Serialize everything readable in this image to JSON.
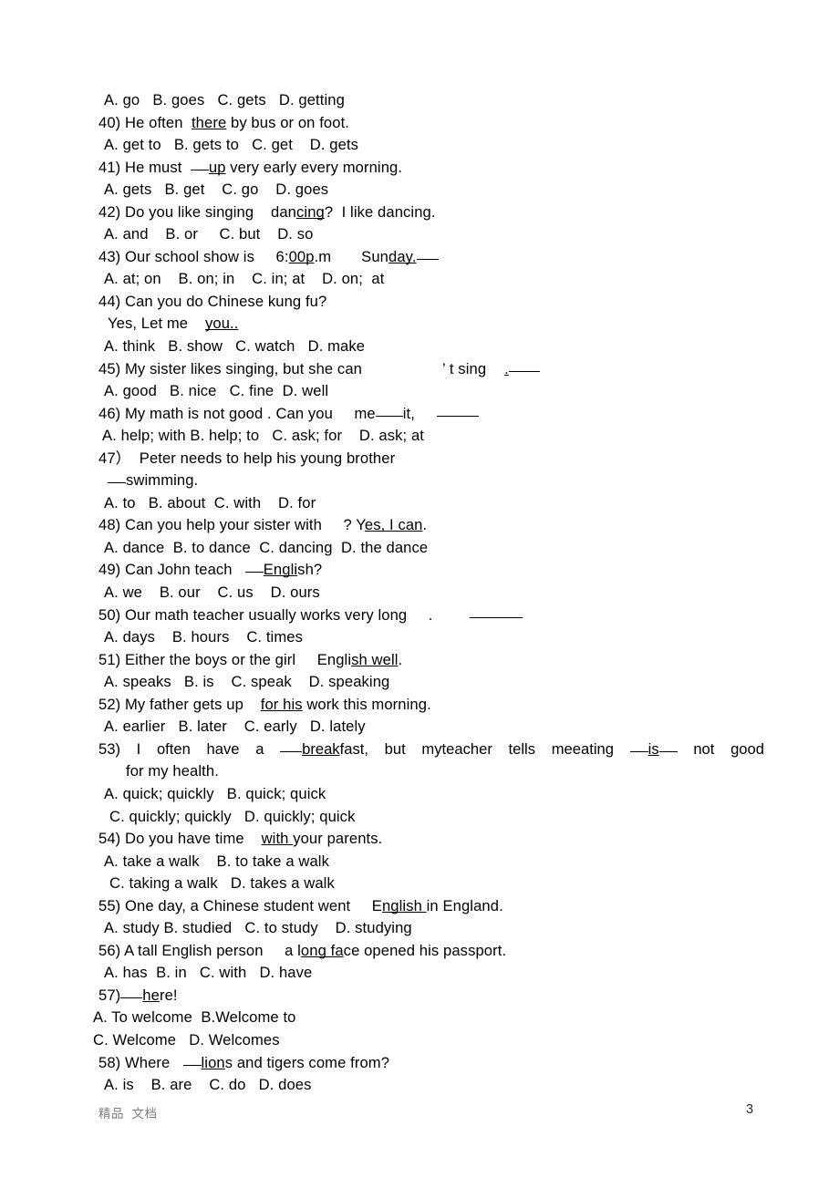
{
  "document": {
    "page_number": "3",
    "watermark": "精品  文档"
  },
  "items": {
    "opt_39": "A. go   B. goes   C. gets   D. getting",
    "q40_a": "40) He often  ",
    "q40_blank": "there",
    "q40_b": " by bus or on foot.",
    "opt_40": "A. get to   B. gets to   C. get    D. gets",
    "q41_a": "41) He must  ",
    "q41_blank": "up",
    "q41_b": " very early every morning.",
    "opt_41": "A. gets   B. get    C. go    D. goes",
    "q42_a": "42) Do you like singing    dan",
    "q42_blank": "cing",
    "q42_b": "?  I like dancing.",
    "opt_42": "A. and    B. or     C. but    D. so",
    "q43_a": "43) Our school show is     6:",
    "q43_blank1": "00p",
    "q43_mid": ".m       Sun",
    "q43_blank2": "day.",
    "opt_43": "A. at; on    B. on; in    C. in; at    D. on;  at",
    "q44": "44) Can you do Chinese kung fu?",
    "q44b_a": "Yes, Let me    ",
    "q44b_blank": "you..",
    "opt_44": "A. think   B. show   C. watch   D. make",
    "q45_a": "45) My sister likes singing, but she can",
    "q45_b": "’ t sing",
    "q45_c": ".",
    "opt_45": "A. good   B. nice   C. fine  D. well",
    "q46_a": "46) My math is not good . Can you     me",
    "q46_b": "it,",
    "q47_a": "47）  Peter needs to help his young brother",
    "q47_b": "swimming.",
    "opt_47": "A. to   B. about  C. with    D. for",
    "q48_a": "48) Can you help your sister with     ? Y",
    "q48_blank": "es, I can",
    "q48_b": ".",
    "opt_48": "A. dance  B. to dance  C. dancing  D. the dance",
    "q49_a": "49) Can John teach   ",
    "q49_blank": "Engli",
    "q49_b": "sh?",
    "opt_49": "A. we    B. our    C. us    D. ours",
    "q50_a": "50) Our math teacher usually works very long     .",
    "opt_50": "A. days    B. hours    C. times",
    "q51_a": "51) Either the boys or the girl     Engli",
    "q51_blank": "sh well",
    "q51_b": ".",
    "opt_51": "A. speaks   B. is    C. speak    D. speaking",
    "q52_a": "52) My father gets up    ",
    "q52_blank": "for his",
    "q52_b": " work this morning.",
    "opt_52": "A. earlier   B. later    C. early   D. lately",
    "q53_w1": "53)",
    "q53_w2": "I",
    "q53_w3": "often",
    "q53_w4": "have a",
    "q53_w5_blankpre": "",
    "q53_w5": "break",
    "q53_w5b": "fast,",
    "q53_w6": "but",
    "q53_w7": "myteacher",
    "q53_w8": "tells",
    "q53_w9": "meeating",
    "q53_w10": "is",
    "q53_w11": "not",
    "q53_w12": "good",
    "q53_cont": "for my health.",
    "opt_53_a": "A. quick; quickly   B. quick; quick",
    "opt_53_b": "C. quickly; quickly   D. quickly; quick",
    "q54_a": "54) Do you have time    ",
    "q54_blank": "with ",
    "q54_b": "your parents.",
    "opt_54_a": "A. take a walk    B. to take a walk",
    "opt_54_b": "C. taking a walk   D. takes a walk",
    "q55_a": "55) One day, a Chinese student went     E",
    "q55_blank": "nglish ",
    "q55_b": "in England.",
    "opt_55": "A. study B. studied   C. to study    D. studying",
    "q56_a": "56) A tall English person     a l",
    "q56_blank": "ong fa",
    "q56_b": "ce opened his passport.",
    "opt_56": "A. has  B. in   C. with   D. have",
    "q57_a": "57)",
    "q57_blank": "he",
    "q57_b": "re!",
    "opt_57_a": "A. To welcome  B.Welcome to",
    "opt_57_b": "C. Welcome   D. Welcomes",
    "q58_a": "58) Where   ",
    "q58_blank": "lion",
    "q58_b": "s and tigers come from?",
    "opt_58": "A. is    B. are    C. do   D. does"
  }
}
